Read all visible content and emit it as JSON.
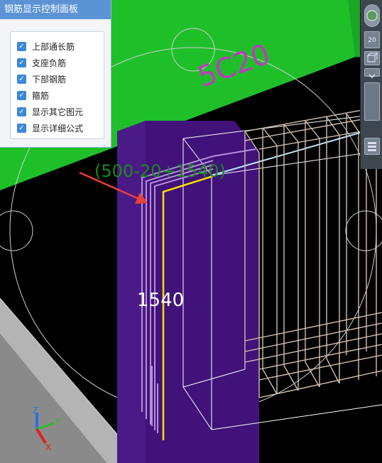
{
  "panel": {
    "title": "钢筋显示控制面板",
    "options": [
      {
        "label": "上部通长筋",
        "checked": true
      },
      {
        "label": "支座负筋",
        "checked": true
      },
      {
        "label": "下部钢筋",
        "checked": true
      },
      {
        "label": "箍筋",
        "checked": true
      },
      {
        "label": "显示其它图元",
        "checked": true
      },
      {
        "label": "显示详细公式",
        "checked": true
      }
    ]
  },
  "viewport": {
    "rebar_label": "5C20",
    "formula_label": "(500-20+1540)",
    "length_label": "1540"
  },
  "toolbar": {
    "zoom_level": "20"
  },
  "axes": {
    "x": "X",
    "y": "Y",
    "z": "Z"
  },
  "colors": {
    "panel_title_bg": "#5b93d6",
    "checkbox": "#3c88d8",
    "slab_green": "#1fbf2a",
    "column_purple": "#40127a",
    "highlight_rebar": "#ffe000",
    "rebar_label": "#c03ac0",
    "formula_label": "#1a8a1a",
    "arrow": "#e8403a"
  }
}
